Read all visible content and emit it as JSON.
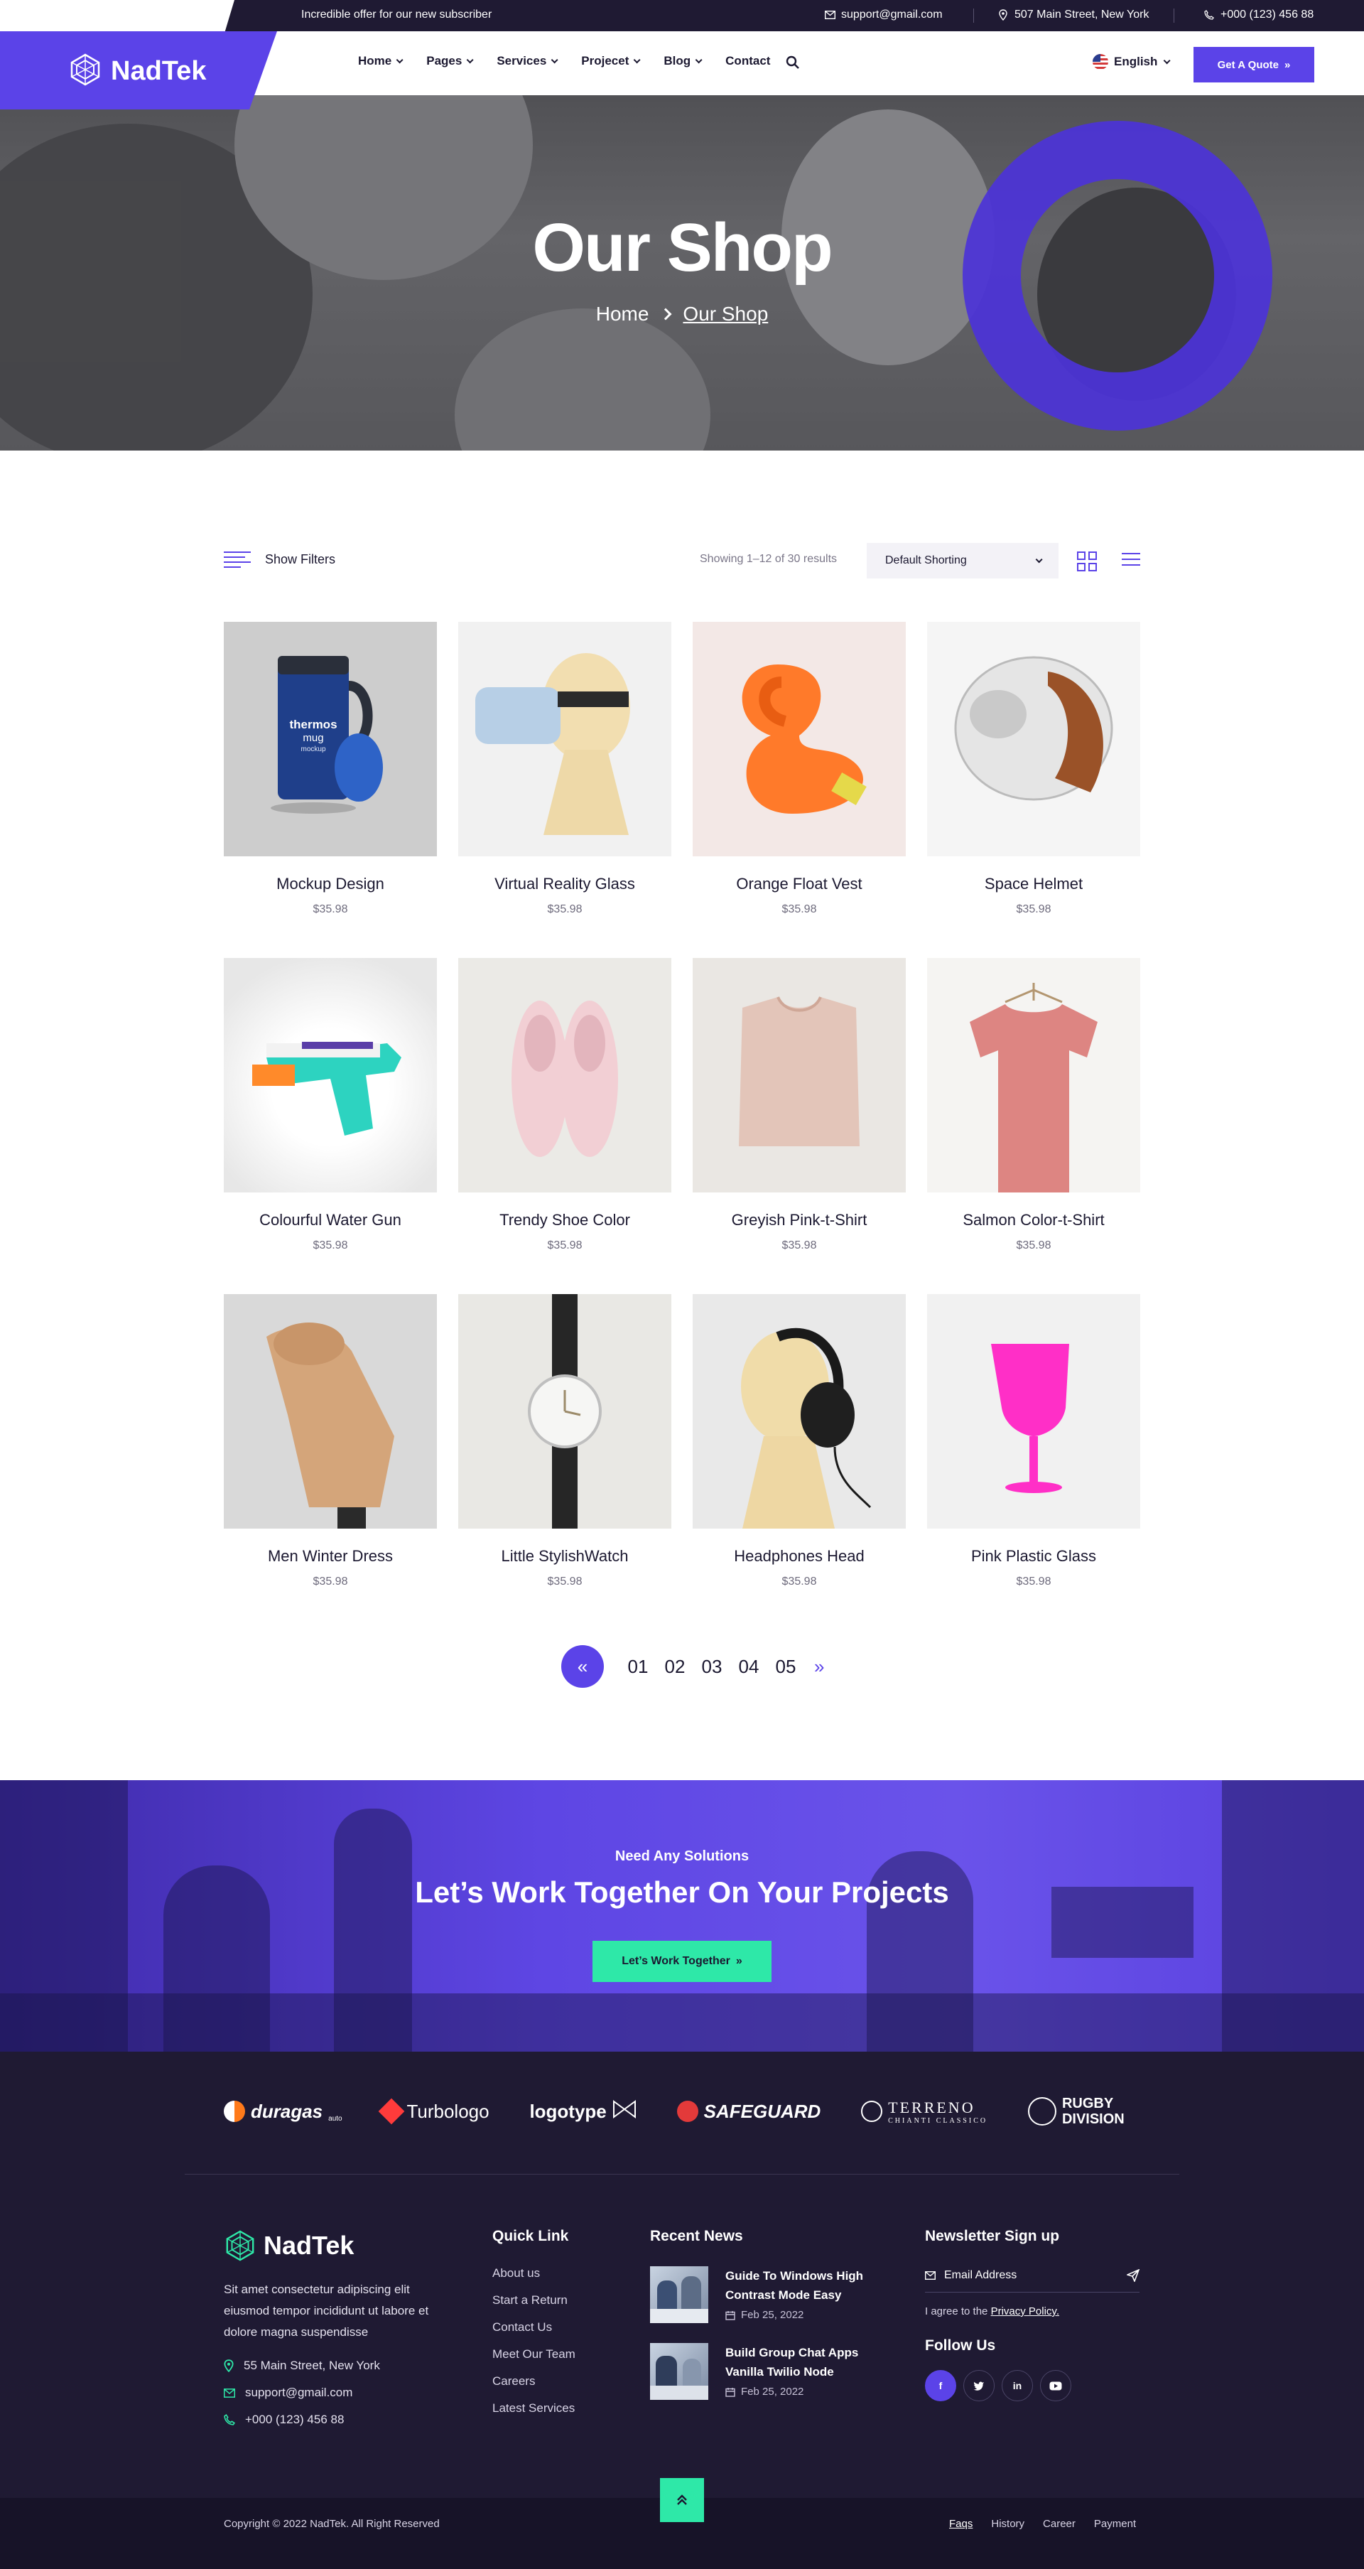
{
  "topbar": {
    "offer": "Incredible offer for our new subscriber",
    "email": "support@gmail.com",
    "address": "507 Main Street, New York",
    "phone": "+000 (123) 456 88"
  },
  "brand": {
    "name": "NadTek"
  },
  "nav": {
    "items": [
      {
        "label": "Home",
        "dropdown": true
      },
      {
        "label": "Pages",
        "dropdown": true
      },
      {
        "label": "Services",
        "dropdown": true
      },
      {
        "label": "Projecet",
        "dropdown": true
      },
      {
        "label": "Blog",
        "dropdown": true
      },
      {
        "label": "Contact",
        "dropdown": false
      }
    ],
    "language": "English",
    "quote_button": "Get A Quote"
  },
  "hero": {
    "title": "Our Shop",
    "breadcrumb": [
      "Home",
      "Our Shop"
    ]
  },
  "shop": {
    "filters_label": "Show Filters",
    "results_text": "Showing 1–12 of 30 results",
    "sort_value": "Default Shorting",
    "products": [
      {
        "name": "Mockup Design",
        "price": "$35.98"
      },
      {
        "name": "Virtual Reality Glass",
        "price": "$35.98"
      },
      {
        "name": "Orange Float Vest",
        "price": "$35.98"
      },
      {
        "name": "Space Helmet",
        "price": "$35.98"
      },
      {
        "name": "Colourful Water Gun",
        "price": "$35.98"
      },
      {
        "name": "Trendy Shoe Color",
        "price": "$35.98"
      },
      {
        "name": "Greyish Pink-t-Shirt",
        "price": "$35.98"
      },
      {
        "name": "Salmon Color-t-Shirt",
        "price": "$35.98"
      },
      {
        "name": "Men Winter Dress",
        "price": "$35.98"
      },
      {
        "name": "Little StylishWatch",
        "price": "$35.98"
      },
      {
        "name": "Headphones Head",
        "price": "$35.98"
      },
      {
        "name": "Pink Plastic Glass",
        "price": "$35.98"
      }
    ],
    "mug_label_1": "thermos",
    "mug_label_2": "mug",
    "mug_label_3": "mockup"
  },
  "pagination": {
    "pages": [
      "01",
      "02",
      "03",
      "04",
      "05"
    ]
  },
  "cta": {
    "kicker": "Need Any Solutions",
    "title": "Let’s Work Together On Your Projects",
    "button": "Let’s Work Together"
  },
  "partners": [
    "duragas",
    "Turbologo",
    "logotype",
    "SAFEGUARD",
    "TERRENO",
    "RUGBY DIVISION"
  ],
  "partner_sub": {
    "duragas": "auto",
    "terreno": "CHIANTI CLASSICO"
  },
  "footer": {
    "brand": "NadTek",
    "description": "Sit amet consectetur adipiscing elit eiusmod tempor incididunt ut labore et dolore magna suspendisse",
    "address": "55 Main Street, New York",
    "email": "support@gmail.com",
    "phone": "+000 (123) 456 88",
    "quick_link_title": "Quick Link",
    "quick_links": [
      "About us",
      "Start a Return",
      "Contact Us",
      "Meet Our Team",
      "Careers",
      "Latest Services"
    ],
    "news_title": "Recent News",
    "news": [
      {
        "title": "Guide To Windows High Contrast Mode Easy",
        "date": "Feb 25, 2022"
      },
      {
        "title": "Build Group Chat Apps Vanilla Twilio Node",
        "date": "Feb 25, 2022"
      }
    ],
    "newsletter_title": "Newsletter Sign up",
    "newsletter_placeholder": "Email Address",
    "agree_prefix": "I agree to the",
    "agree_link": "Privacy Policy.",
    "follow_title": "Follow Us",
    "socials": [
      "f",
      "t",
      "in",
      "yt"
    ],
    "copyright": "Copyright © 2022 NadTek. All Right Reserved",
    "bottom_links": [
      "Faqs",
      "History",
      "Career",
      "Payment"
    ]
  },
  "colors": {
    "primary": "#5b43e8",
    "accent": "#2ee8a8",
    "dark": "#1f1a33"
  }
}
